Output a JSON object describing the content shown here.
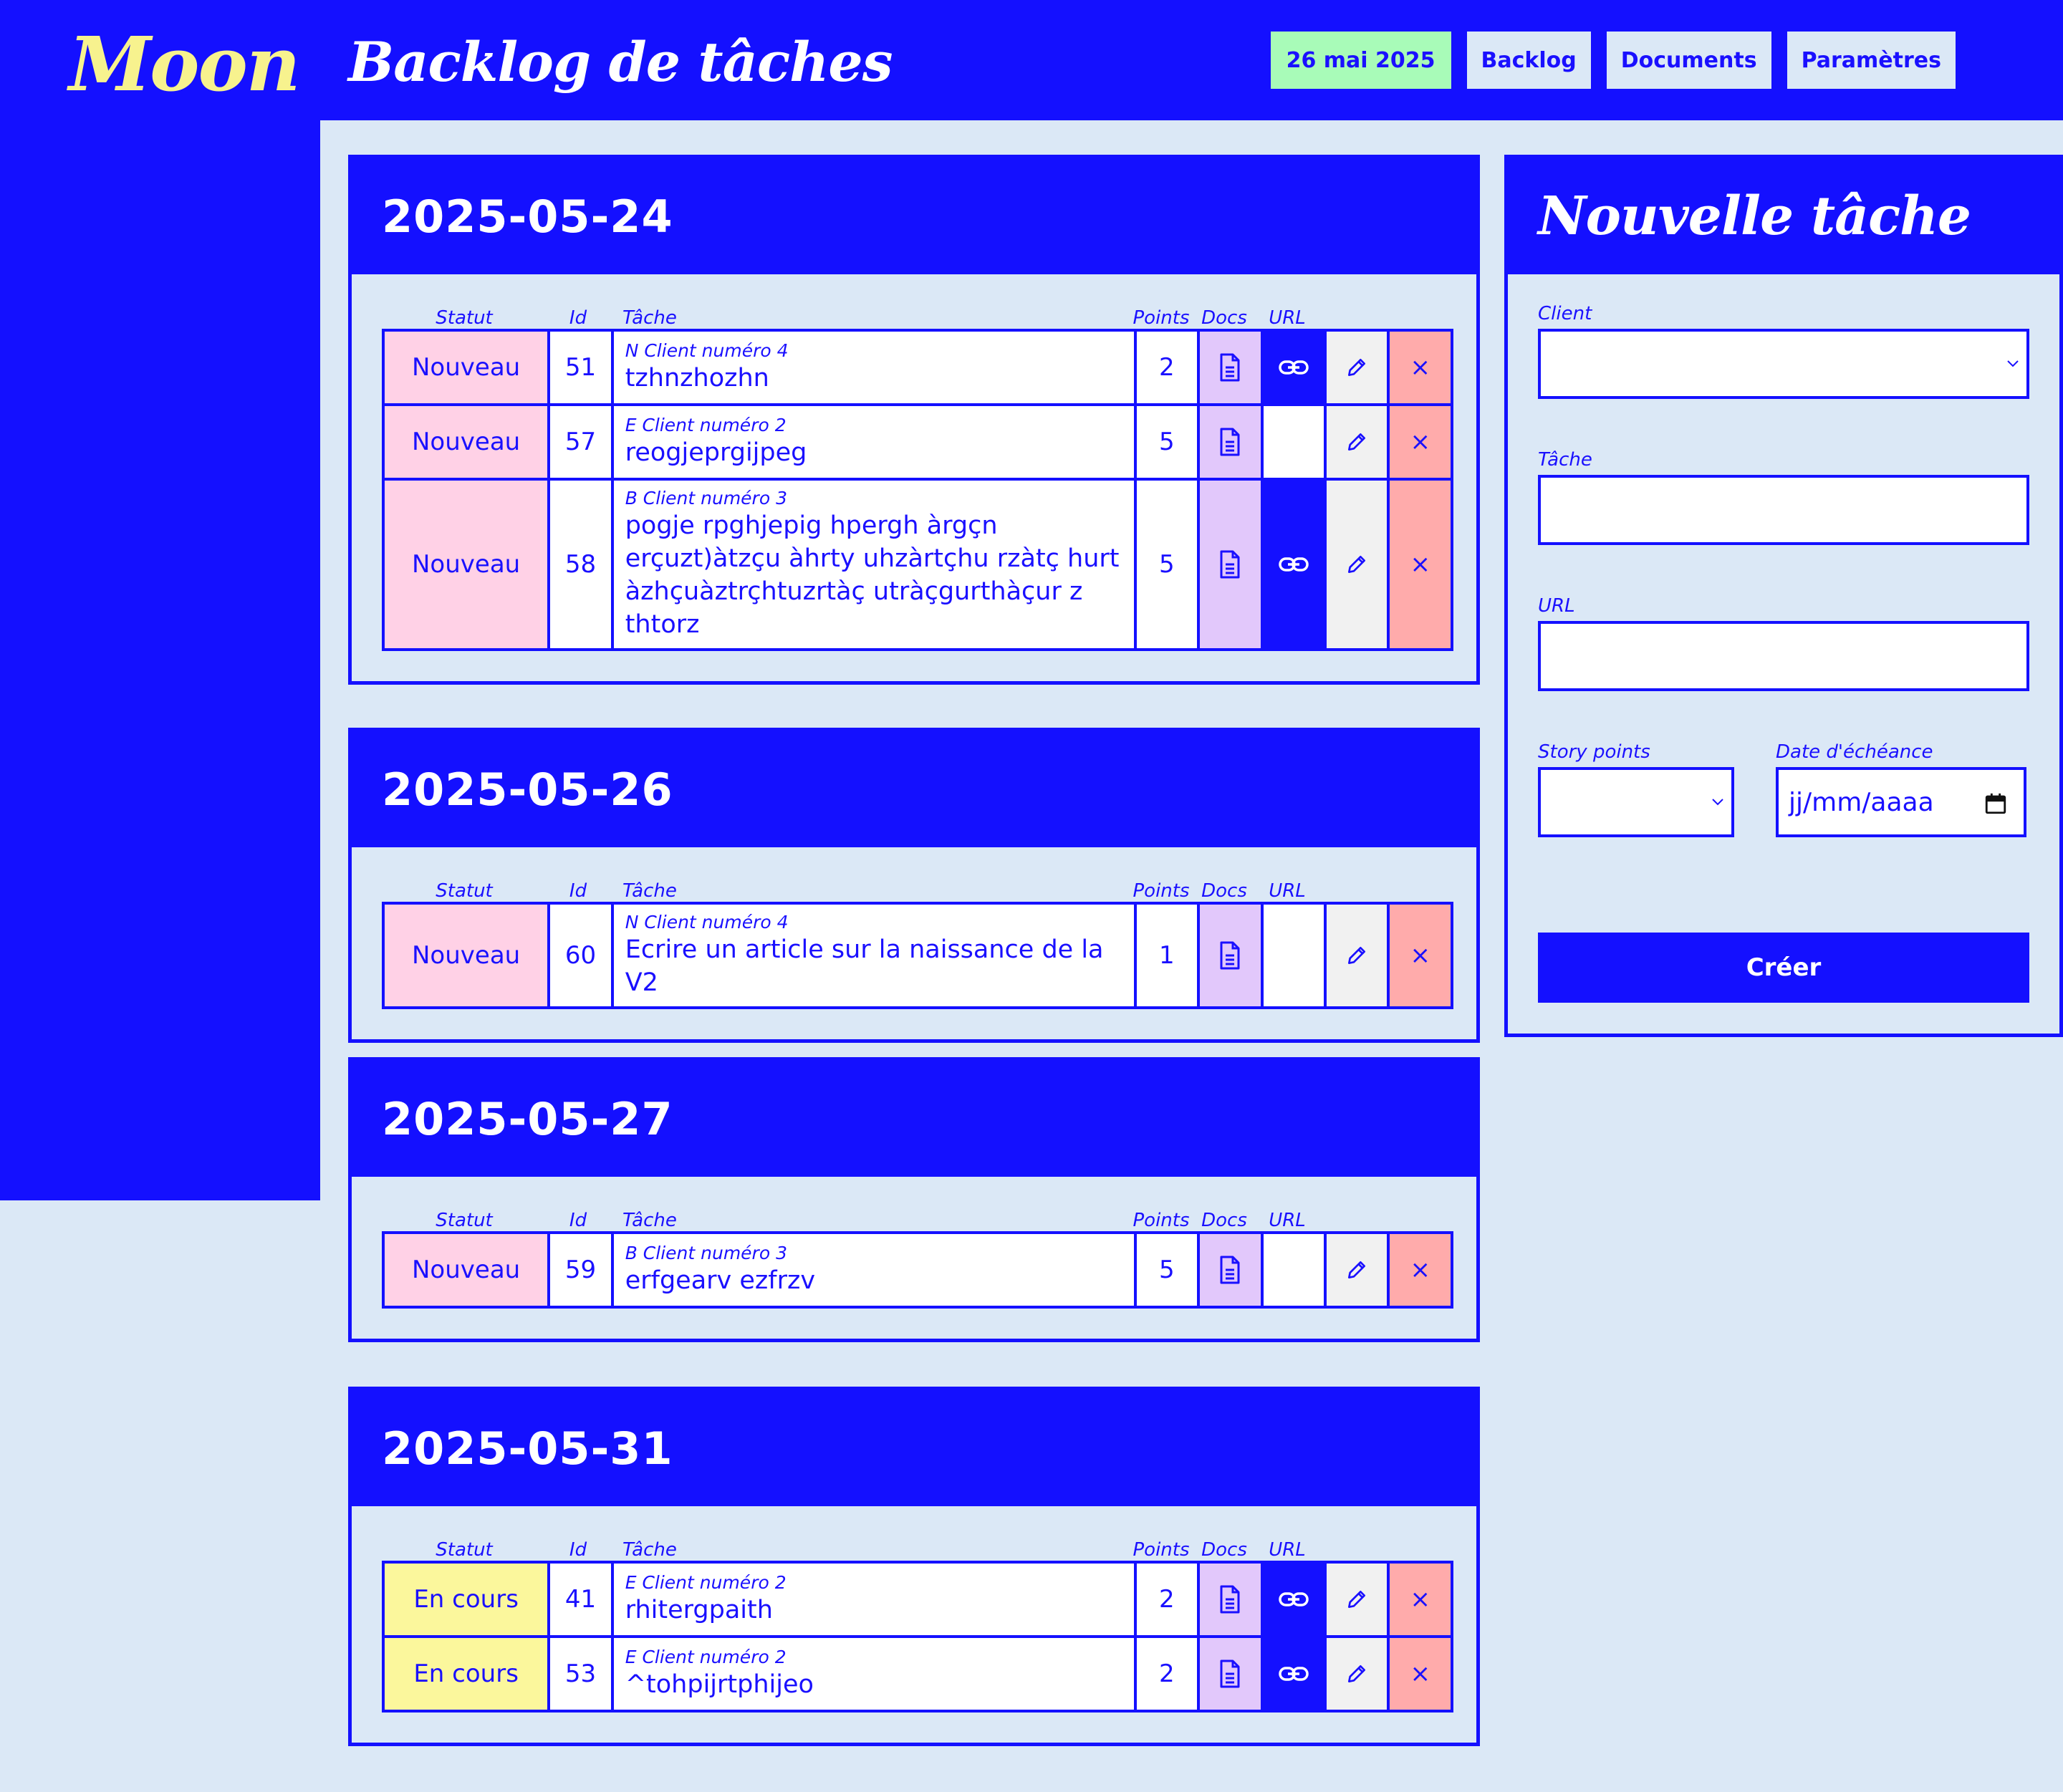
{
  "app": {
    "logo": "Moon",
    "page_title": "Backlog de tâches"
  },
  "nav": {
    "date": "26 mai 2025",
    "backlog": "Backlog",
    "documents": "Documents",
    "settings": "Paramètres"
  },
  "columns": {
    "statut": "Statut",
    "id": "Id",
    "tache": "Tâche",
    "points": "Points",
    "docs": "Docs",
    "url": "URL"
  },
  "delete_glyph": "×",
  "groups": [
    {
      "date": "2025-05-24",
      "rows": [
        {
          "status": "Nouveau",
          "id": "51",
          "client": "N Client numéro 4",
          "task": "tzhnzhozhn",
          "points": "2",
          "has_url": true
        },
        {
          "status": "Nouveau",
          "id": "57",
          "client": "E Client numéro 2",
          "task": "reogjeprgijpeg",
          "points": "5",
          "has_url": false
        },
        {
          "status": "Nouveau",
          "id": "58",
          "client": "B Client numéro 3",
          "task": "pogje rpghjepig hpergh àrgçn erçuzt)àtzçu àhrty uhzàrtçhu rzàtç hurt àzhçuàztrçhtuzrtàç utràçgurthàçur z thtorz",
          "points": "5",
          "has_url": true
        }
      ]
    },
    {
      "date": "2025-05-26",
      "rows": [
        {
          "status": "Nouveau",
          "id": "60",
          "client": "N Client numéro 4",
          "task": "Ecrire un article sur la naissance de la V2",
          "points": "1",
          "has_url": false
        }
      ]
    },
    {
      "date": "2025-05-27",
      "rows": [
        {
          "status": "Nouveau",
          "id": "59",
          "client": "B Client numéro 3",
          "task": "erfgearv ezfrzv",
          "points": "5",
          "has_url": false
        }
      ]
    },
    {
      "date": "2025-05-31",
      "rows": [
        {
          "status": "En cours",
          "id": "41",
          "client": "E Client numéro 2",
          "task": "rhitergpaith",
          "points": "2",
          "has_url": true
        },
        {
          "status": "En cours",
          "id": "53",
          "client": "E Client numéro 2",
          "task": "^tohpijrtphijeo",
          "points": "2",
          "has_url": true
        }
      ]
    }
  ],
  "form": {
    "title": "Nouvelle tâche",
    "client_label": "Client",
    "client_value": "",
    "task_label": "Tâche",
    "task_value": "",
    "url_label": "URL",
    "url_value": "",
    "points_label": "Story points",
    "points_value": "",
    "due_label": "Date d'échéance",
    "due_placeholder": "jj/mm/aaaa",
    "submit": "Créer"
  },
  "colors": {
    "primary": "#1410ff",
    "background": "#dbe8f6",
    "logo": "#f7f28e",
    "status_new": "#ffd1e6",
    "status_in_progress": "#fbf79c",
    "docs": "#e2c8fb",
    "delete": "#ffabab",
    "date_badge": "#a8fbb8"
  }
}
